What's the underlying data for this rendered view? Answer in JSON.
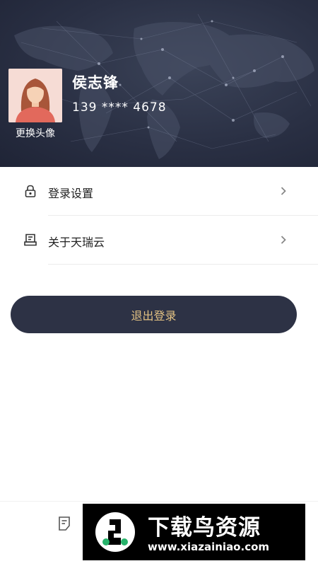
{
  "profile": {
    "name": "侯志锋",
    "phone": "139 **** 4678",
    "change_avatar_label": "更换头像"
  },
  "menu": {
    "items": [
      {
        "label": "登录设置",
        "icon": "lock-icon"
      },
      {
        "label": "关于天瑞云",
        "icon": "info-card-icon"
      }
    ]
  },
  "logout_label": "退出登录",
  "bottom_nav": {
    "icon": "document-icon"
  },
  "watermark": {
    "title": "下载鸟资源",
    "url": "www.xiazainiao.com"
  },
  "colors": {
    "header_bg": "#2a3044",
    "button_bg": "#2d3245",
    "button_text": "#e3c283"
  }
}
